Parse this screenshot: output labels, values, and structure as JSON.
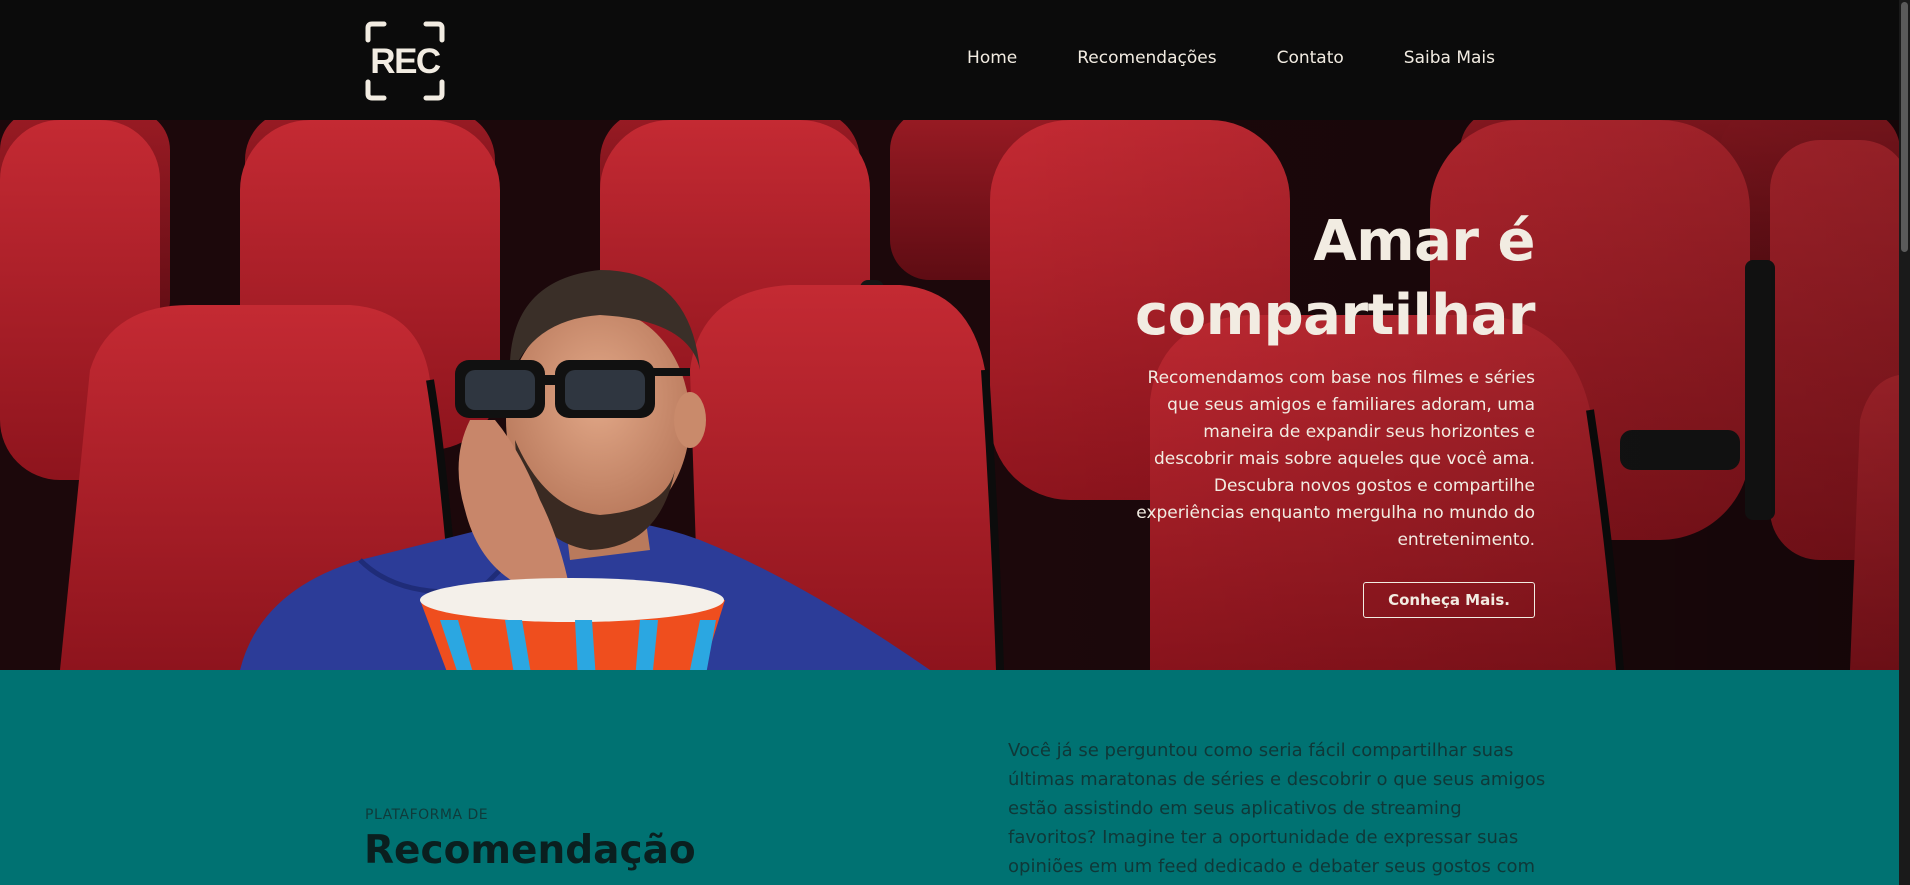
{
  "header": {
    "logo_text": "REC",
    "nav": [
      {
        "label": "Home"
      },
      {
        "label": "Recomendações"
      },
      {
        "label": "Contato"
      },
      {
        "label": "Saiba Mais"
      }
    ]
  },
  "hero": {
    "title_line1": "Amar é",
    "title_line2": "compartilhar",
    "description": "Recomendamos com base nos filmes e séries que seus amigos e familiares adoram, uma maneira de expandir seus horizontes e descobrir mais sobre aqueles que você ama. Descubra novos gostos e compartilhe experiências enquanto mergulha no mundo do entretenimento.",
    "button_label": "Conheça Mais."
  },
  "about": {
    "eyebrow": "PLATAFORMA DE",
    "title": "Recomendação",
    "text": "Você já se perguntou como seria fácil compartilhar suas últimas maratonas de séries e descobrir o que seus amigos estão assistindo em seus aplicativos de streaming favoritos? Imagine ter a oportunidade de expressar suas opiniões em um feed dedicado e debater seus gostos com"
  },
  "colors": {
    "header_bg": "#0b0b0b",
    "cream": "#f2ece2",
    "teal": "#007272",
    "seat_red": "#b51f2a"
  }
}
